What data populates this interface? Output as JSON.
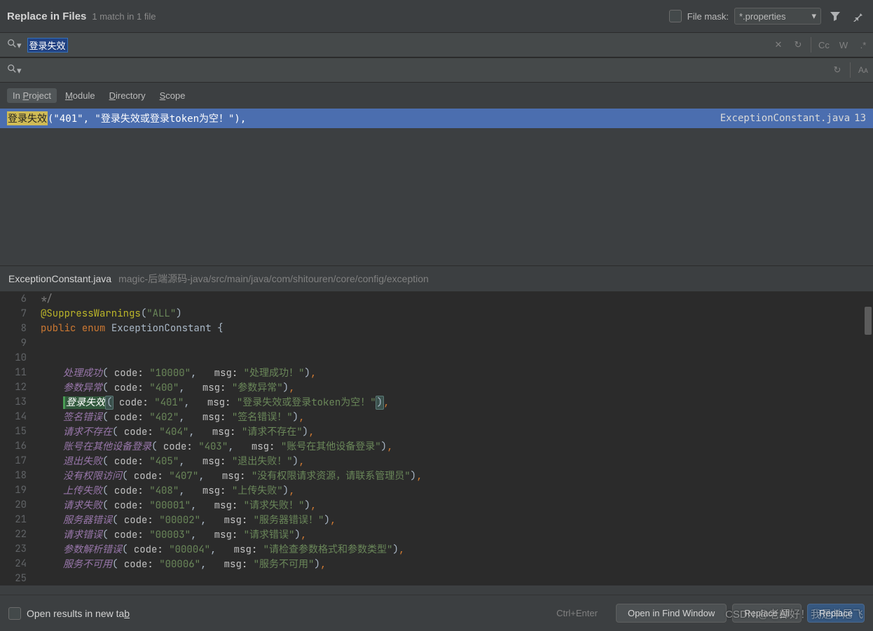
{
  "header": {
    "title": "Replace in Files",
    "subtitle": "1 match in 1 file",
    "file_mask_label": "File mask:",
    "file_mask_value": "*.properties"
  },
  "search": {
    "value": "登录失效",
    "cc": "Cc",
    "w": "W",
    "regex": ".*"
  },
  "replace": {
    "value": "",
    "aa": "Aᴀ"
  },
  "scope": {
    "tabs": [
      "In Project",
      "Module",
      "Directory",
      "Scope"
    ],
    "active": 0
  },
  "result": {
    "highlight": "登录失效",
    "rest": "(\"401\", \"登录失效或登录token为空！\"),",
    "file": "ExceptionConstant.java",
    "line": "13"
  },
  "file_open": {
    "name": "ExceptionConstant.java",
    "path": "magic-后端源码-java/src/main/java/com/shitouren/core/config/exception"
  },
  "code": {
    "lines": [
      {
        "num": 6,
        "kind": "comment",
        "text": "*/"
      },
      {
        "num": 7,
        "kind": "annot",
        "annot": "@SuppressWarnings",
        "paren_l": "(",
        "str": "\"ALL\"",
        "paren_r": ")"
      },
      {
        "num": 8,
        "kind": "decl",
        "kw1": "public",
        "kw2": "enum",
        "type": "ExceptionConstant",
        "brace": " {"
      },
      {
        "num": 9,
        "kind": "blank"
      },
      {
        "num": 10,
        "kind": "blank"
      },
      {
        "num": 11,
        "kind": "entry",
        "name": "处理成功",
        "code": "\"10000\"",
        "msg": "\"处理成功！\""
      },
      {
        "num": 12,
        "kind": "entry",
        "name": "参数异常",
        "code": "\"400\"",
        "msg": "\"参数异常\""
      },
      {
        "num": 13,
        "kind": "match",
        "name": "登录失效",
        "code": "\"401\"",
        "msg": "\"登录失效或登录token为空！\""
      },
      {
        "num": 14,
        "kind": "entry",
        "name": "签名错误",
        "code": "\"402\"",
        "msg": "\"签名错误！\""
      },
      {
        "num": 15,
        "kind": "entry",
        "name": "请求不存在",
        "code": "\"404\"",
        "msg": "\"请求不存在\""
      },
      {
        "num": 16,
        "kind": "entry",
        "name": "账号在其他设备登录",
        "code": "\"403\"",
        "msg": "\"账号在其他设备登录\""
      },
      {
        "num": 17,
        "kind": "entry",
        "name": "退出失败",
        "code": "\"405\"",
        "msg": "\"退出失败！\""
      },
      {
        "num": 18,
        "kind": "entry",
        "name": "没有权限访问",
        "code": "\"407\"",
        "msg": "\"没有权限请求资源，请联系管理员\""
      },
      {
        "num": 19,
        "kind": "entry",
        "name": "上传失败",
        "code": "\"408\"",
        "msg": "\"上传失败\""
      },
      {
        "num": 20,
        "kind": "entry",
        "name": "请求失败",
        "code": "\"00001\"",
        "msg": "\"请求失败！\""
      },
      {
        "num": 21,
        "kind": "entry",
        "name": "服务器错误",
        "code": "\"00002\"",
        "msg": "\"服务器错误！\""
      },
      {
        "num": 22,
        "kind": "entry",
        "name": "请求错误",
        "code": "\"00003\"",
        "msg": "\"请求错误\""
      },
      {
        "num": 23,
        "kind": "entry",
        "name": "参数解析错误",
        "code": "\"00004\"",
        "msg": "\"请检查参数格式和参数类型\""
      },
      {
        "num": 24,
        "kind": "entry",
        "name": "服务不可用",
        "code": "\"00006\"",
        "msg": "\"服务不可用\""
      },
      {
        "num": 25,
        "kind": "blank"
      }
    ]
  },
  "footer": {
    "open_tab": "Open results in new tab",
    "hint": "Ctrl+Enter",
    "open_window": "Open in Find Window",
    "replace_all": "Replace All",
    "replace": "Replace"
  },
  "watermark": "CSDN @老师好！我是羊尼飞"
}
